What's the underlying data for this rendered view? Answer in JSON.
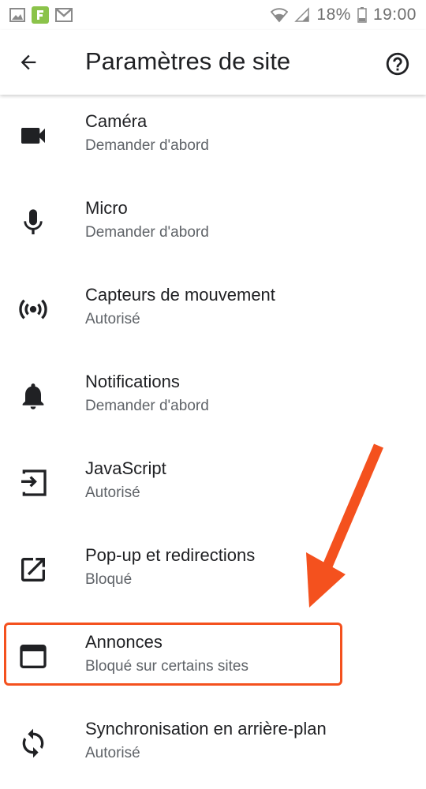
{
  "status_bar": {
    "battery_percent": "18%",
    "time": "19:00"
  },
  "app_bar": {
    "title": "Paramètres de site"
  },
  "settings": [
    {
      "label": "Caméra",
      "status": "Demander d'abord",
      "icon": "camera-icon"
    },
    {
      "label": "Micro",
      "status": "Demander d'abord",
      "icon": "microphone-icon"
    },
    {
      "label": "Capteurs de mouvement",
      "status": "Autorisé",
      "icon": "sensors-icon"
    },
    {
      "label": "Notifications",
      "status": "Demander d'abord",
      "icon": "bell-icon"
    },
    {
      "label": "JavaScript",
      "status": "Autorisé",
      "icon": "javascript-icon"
    },
    {
      "label": "Pop-up et redirections",
      "status": "Bloqué",
      "icon": "open-in-new-icon"
    },
    {
      "label": "Annonces",
      "status": "Bloqué sur certains sites",
      "icon": "ads-window-icon"
    },
    {
      "label": "Synchronisation en arrière-plan",
      "status": "Autorisé",
      "icon": "sync-icon"
    }
  ],
  "colors": {
    "annotation": "#f4511e",
    "text_primary": "#202124",
    "text_secondary": "#5f6368"
  }
}
